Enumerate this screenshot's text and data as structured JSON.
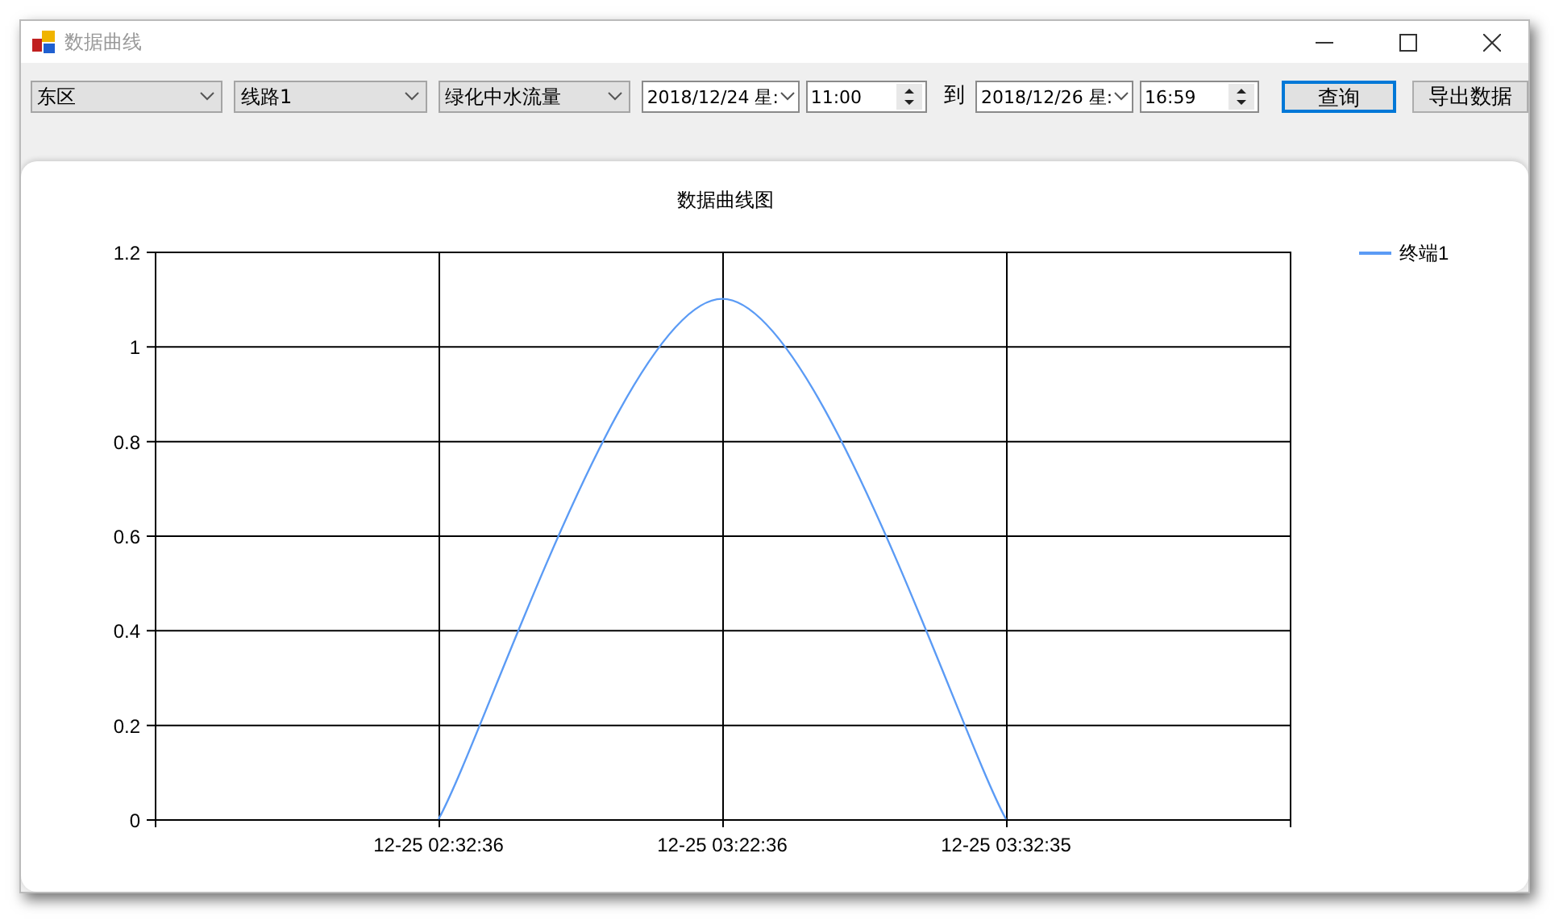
{
  "window": {
    "title": "数据曲线"
  },
  "toolbar": {
    "selectors": [
      {
        "kind": "combo",
        "value": "东区"
      },
      {
        "kind": "combo",
        "value": "线路1"
      },
      {
        "kind": "combo",
        "value": "绿化中水流量"
      }
    ],
    "start": {
      "date": "2018/12/24 星:",
      "time": "11:00"
    },
    "to_label": "到",
    "end": {
      "date": "2018/12/26 星:",
      "time": "16:59"
    },
    "buttons": [
      {
        "label": "查询",
        "focused": true
      },
      {
        "label": "导出数据",
        "focused": false
      }
    ]
  },
  "chart": {
    "chart_data": {
      "type": "line",
      "title": "数据曲线图",
      "categories": [
        null,
        "12-25 02:32:36",
        "12-25 03:22:36",
        "12-25 03:32:35",
        null
      ],
      "series": [
        {
          "name": "终端1",
          "color": "#5b9bf5",
          "values": [
            null,
            0,
            1.1,
            0,
            null
          ]
        }
      ],
      "ylim": [
        0,
        1.2
      ],
      "grid": true,
      "yticks": [
        0,
        0.2,
        0.4,
        0.6,
        0.8,
        1,
        1.2
      ]
    }
  }
}
